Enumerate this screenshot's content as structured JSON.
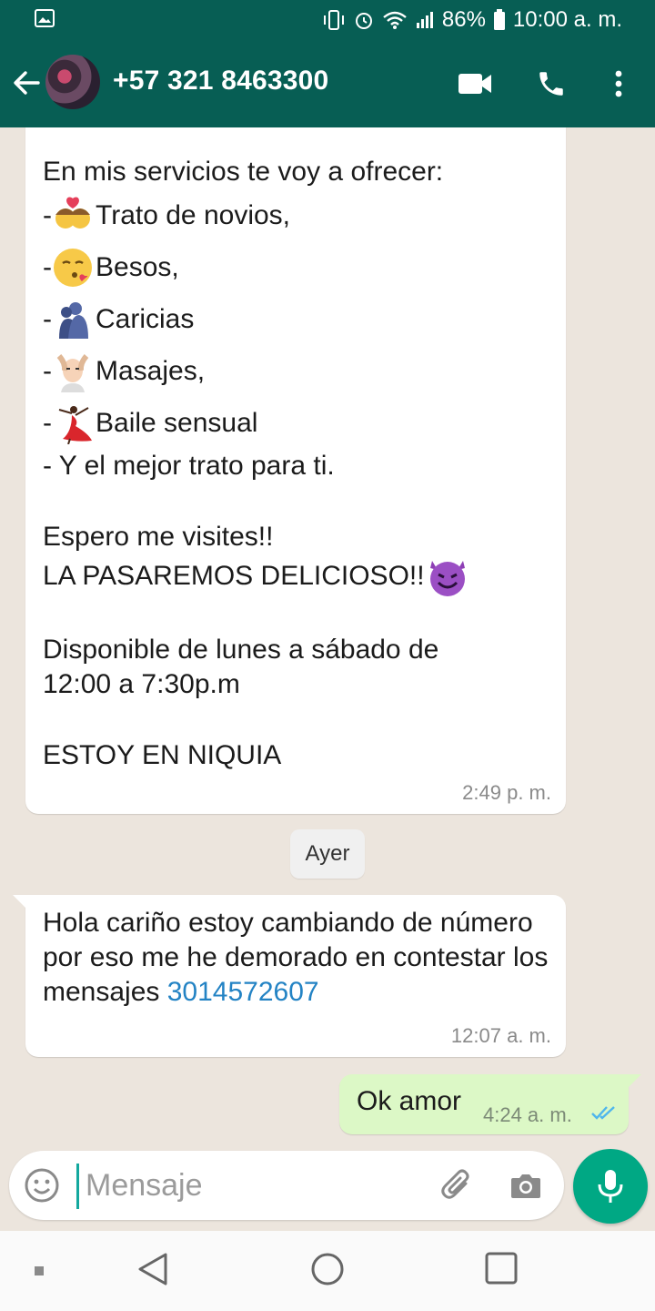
{
  "status": {
    "battery_text": "86%",
    "time_text": "10:00 a. m."
  },
  "header": {
    "contact": "+57 321 8463300"
  },
  "messages": {
    "first": {
      "lines": [
        "En mis servicios te voy a ofrecer:",
        "-",
        "Trato de novios,",
        "-",
        "Besos,",
        "- ",
        "Caricias",
        "- ",
        "Masajes,",
        "-",
        "Baile sensual",
        "- Y el mejor trato para ti.",
        "Espero me visites!!",
        "LA PASAREMOS DELICIOSO!! ",
        "Disponible de lunes a sábado de",
        "12:00 a 7:30p.m",
        "ESTOY EN  NIQUIA"
      ],
      "time": "2:49 p. m."
    },
    "date_chip": "Ayer",
    "second": {
      "text": "Hola cariño estoy cambiando de número por eso me he demorado en contestar los mensajes ",
      "phone_link": "3014572607",
      "time": "12:07 a. m."
    },
    "third": {
      "text": "Ok amor",
      "time": "4:24 a. m."
    }
  },
  "input": {
    "placeholder": "Mensaje"
  },
  "colors": {
    "header": "#075e54",
    "accent": "#00a884",
    "outgoing_bubble": "#dcf8c6",
    "link": "#2383c4"
  },
  "icons": {
    "status_left": "gallery-icon",
    "back": "arrow-left-icon",
    "video": "video-call-icon",
    "call": "phone-icon",
    "menu": "more-vert-icon",
    "emoji": "emoji-icon",
    "attach": "paperclip-icon",
    "camera": "camera-icon",
    "mic": "mic-icon"
  }
}
